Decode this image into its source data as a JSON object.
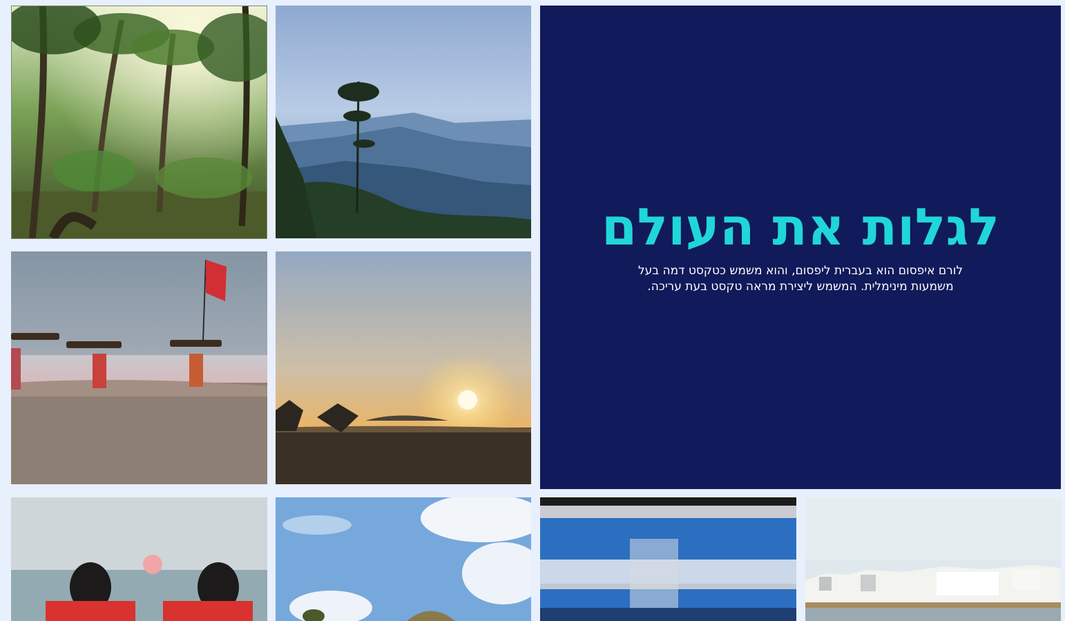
{
  "hero": {
    "title": "לגלות את העולם",
    "body": "לורם איפסום הוא בעברית ליפסום, והוא משמש כטקסט דמה בעל משמעות מינימלית. המשמש ליצירת מראה טקסט בעת עריכה."
  },
  "colors": {
    "page_bg": "#e8effd",
    "hero_bg": "#111a5a",
    "hero_title": "#20d6d8",
    "hero_text": "#ffffff"
  },
  "gallery": [
    {
      "subject": "palm-forest-photo"
    },
    {
      "subject": "misty-mountains-photo"
    },
    {
      "subject": "beach-women-carrying-wood-photo"
    },
    {
      "subject": "sunset-tidal-flat-photo"
    },
    {
      "subject": "women-watching-sunset-sea-photo"
    },
    {
      "subject": "sky-clouds-dome-photo"
    },
    {
      "subject": "blurred-blue-train-photo"
    },
    {
      "subject": "white-town-lakeside-photo"
    }
  ]
}
